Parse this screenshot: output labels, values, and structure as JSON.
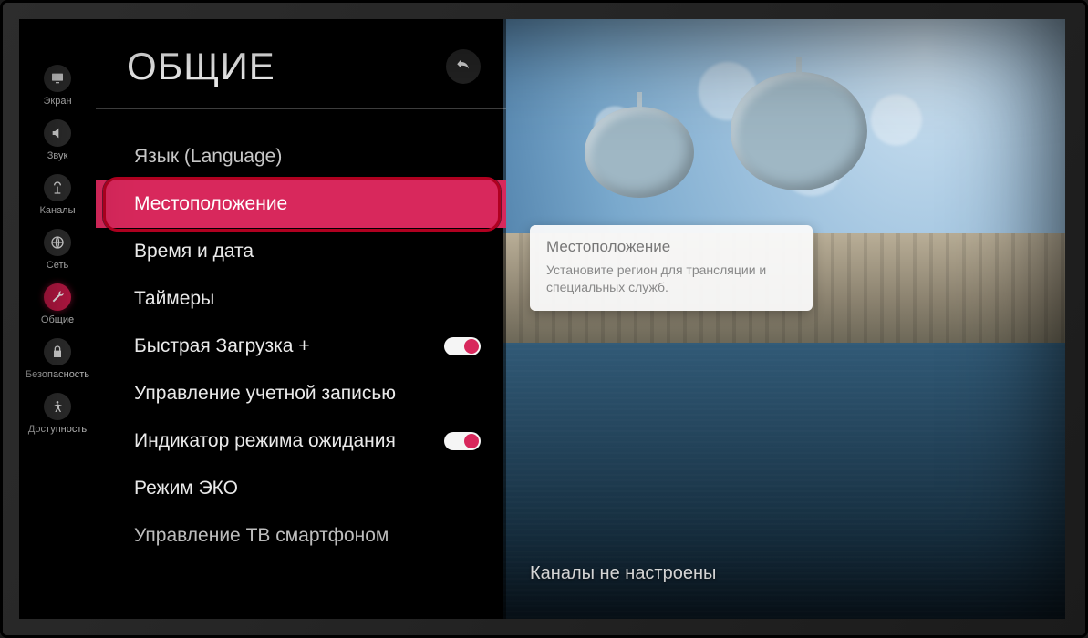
{
  "rail": [
    {
      "id": "screen",
      "label": "Экран"
    },
    {
      "id": "sound",
      "label": "Звук"
    },
    {
      "id": "channels",
      "label": "Каналы"
    },
    {
      "id": "network",
      "label": "Сеть"
    },
    {
      "id": "general",
      "label": "Общие",
      "active": true
    },
    {
      "id": "security",
      "label": "Безопасность"
    },
    {
      "id": "accessibility",
      "label": "Доступность"
    }
  ],
  "menu": {
    "title": "ОБЩИЕ",
    "items": [
      {
        "id": "language",
        "label": "Язык (Language)",
        "partial": true
      },
      {
        "id": "location",
        "label": "Местоположение",
        "selected": true,
        "highlighted": true
      },
      {
        "id": "datetime",
        "label": "Время и дата"
      },
      {
        "id": "timers",
        "label": "Таймеры"
      },
      {
        "id": "quickstart",
        "label": "Быстрая Загрузка +",
        "toggle": true,
        "toggle_on": true
      },
      {
        "id": "account",
        "label": "Управление учетной записью"
      },
      {
        "id": "standby-led",
        "label": "Индикатор режима ожидания",
        "toggle": true,
        "toggle_on": true
      },
      {
        "id": "eco",
        "label": "Режим ЭКО"
      },
      {
        "id": "phone-ctrl",
        "label": "Управление ТВ смартфоном",
        "partial": true
      }
    ]
  },
  "info": {
    "title": "Местоположение",
    "body": "Установите регион для трансляции и специальных служб."
  },
  "status": "Каналы не настроены",
  "icons": {
    "screen": "monitor",
    "sound": "speaker",
    "channels": "satellite",
    "network": "globe",
    "general": "wrench",
    "security": "lock",
    "accessibility": "person"
  }
}
